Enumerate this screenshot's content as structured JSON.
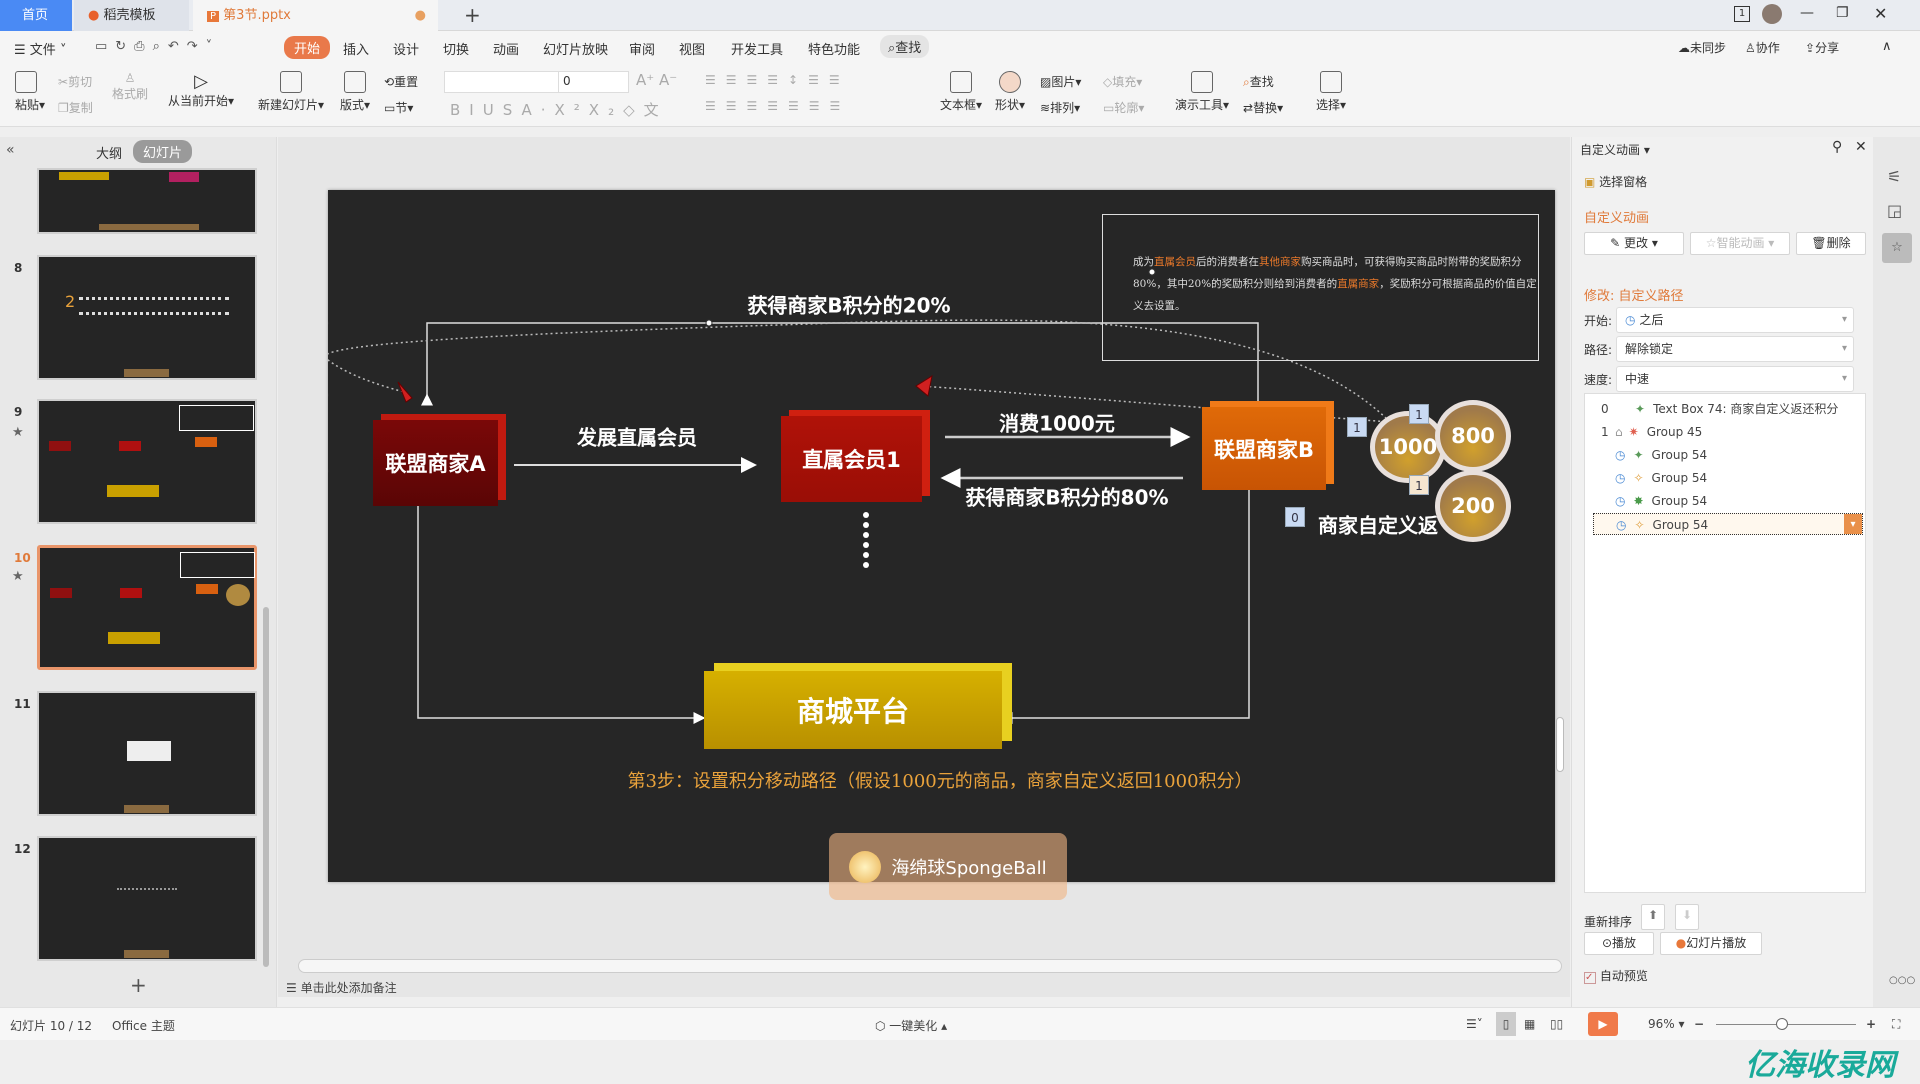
{
  "tabs": [
    {
      "label": "首页",
      "active": true
    },
    {
      "label": "稻壳模板"
    },
    {
      "label": "第3节.pptx"
    }
  ],
  "window": {
    "badge": "1"
  },
  "menu": {
    "file": "文件",
    "items": [
      "开始",
      "插入",
      "设计",
      "切换",
      "动画",
      "幻灯片放映",
      "审阅",
      "视图",
      "开发工具",
      "特色功能"
    ],
    "search": "查找",
    "sync": "未同步",
    "collab": "协作",
    "share": "分享"
  },
  "ribbon": {
    "paste": "粘贴",
    "cut": "剪切",
    "copy": "复制",
    "format_painter": "格式刷",
    "from_current": "从当前开始",
    "new_slide": "新建幻灯片",
    "layout": "版式",
    "reset": "重置",
    "section": "节",
    "font_size": "0",
    "textbox": "文本框",
    "shape": "形状",
    "picture": "图片",
    "fill": "填充",
    "arrange": "排列",
    "outline": "轮廓",
    "present_tools": "演示工具",
    "find": "查找",
    "replace": "替换",
    "select": "选择"
  },
  "left": {
    "outline": "大纲",
    "slides": "幻灯片",
    "thumbs": [
      {
        "num": ""
      },
      {
        "num": "8"
      },
      {
        "num": "9",
        "star": true
      },
      {
        "num": "10",
        "star": true,
        "selected": true
      },
      {
        "num": "11"
      },
      {
        "num": "12"
      }
    ]
  },
  "slide": {
    "desc_parts": [
      {
        "t": "成为"
      },
      {
        "t": "直属会员",
        "hl": true
      },
      {
        "t": "后的消费者在"
      },
      {
        "t": "其他商家",
        "hl": true
      },
      {
        "t": "购买商品时，可获得购买商品时附带的奖励积分80%，其中20%的奖励积分则给到消费者的"
      },
      {
        "t": "直属商家",
        "hl": true
      },
      {
        "t": "，奖励积分可根据商品的价值自定义去设置。"
      }
    ],
    "top_label": "获得商家B积分的20%",
    "box_a": "联盟商家A",
    "develop": "发展直属会员",
    "box_1": "直属会员1",
    "spend": "消费1000元",
    "get80": "获得商家B积分的80%",
    "box_b": "联盟商家B",
    "platform": "商城平台",
    "coins": [
      "1000",
      "800",
      "200"
    ],
    "custom_return": "商家自定义返",
    "step": "第3步：设置积分移动路径（假设1000元的商品，商家自定义返回1000积分）",
    "logo_text": "海绵球SpongeBall",
    "badges": [
      "0",
      "1",
      "1",
      "1"
    ],
    "highlight_color": "#e8782a",
    "step_color": "#e9a23b"
  },
  "notes_placeholder": "单击此处添加备注",
  "anim": {
    "title": "自定义动画",
    "select_pane": "选择窗格",
    "section": "自定义动画",
    "change": "更改",
    "smart": "智能动画",
    "delete": "删除",
    "modify": "修改: 自定义路径",
    "start_label": "开始:",
    "start_value": "之后",
    "path_label": "路径:",
    "path_value": "解除锁定",
    "speed_label": "速度:",
    "speed_value": "中速",
    "items": [
      {
        "n": "0",
        "name": "Text Box 74: 商家自定义返还积分"
      },
      {
        "n": "1",
        "name": "Group 45"
      },
      {
        "n": "",
        "name": "Group 54"
      },
      {
        "n": "",
        "name": "Group 54"
      },
      {
        "n": "",
        "name": "Group 54"
      },
      {
        "n": "",
        "name": "Group 54",
        "selected": true
      }
    ],
    "reorder": "重新排序",
    "play": "播放",
    "slideshow": "幻灯片播放",
    "autopreview": "自动预览",
    "autopreview_checked": true
  },
  "status": {
    "slide": "幻灯片 10 / 12",
    "theme": "Office 主题",
    "beautify": "一键美化",
    "zoom": "96%",
    "zoom_level": 96
  },
  "watermark": "亿海收录网"
}
